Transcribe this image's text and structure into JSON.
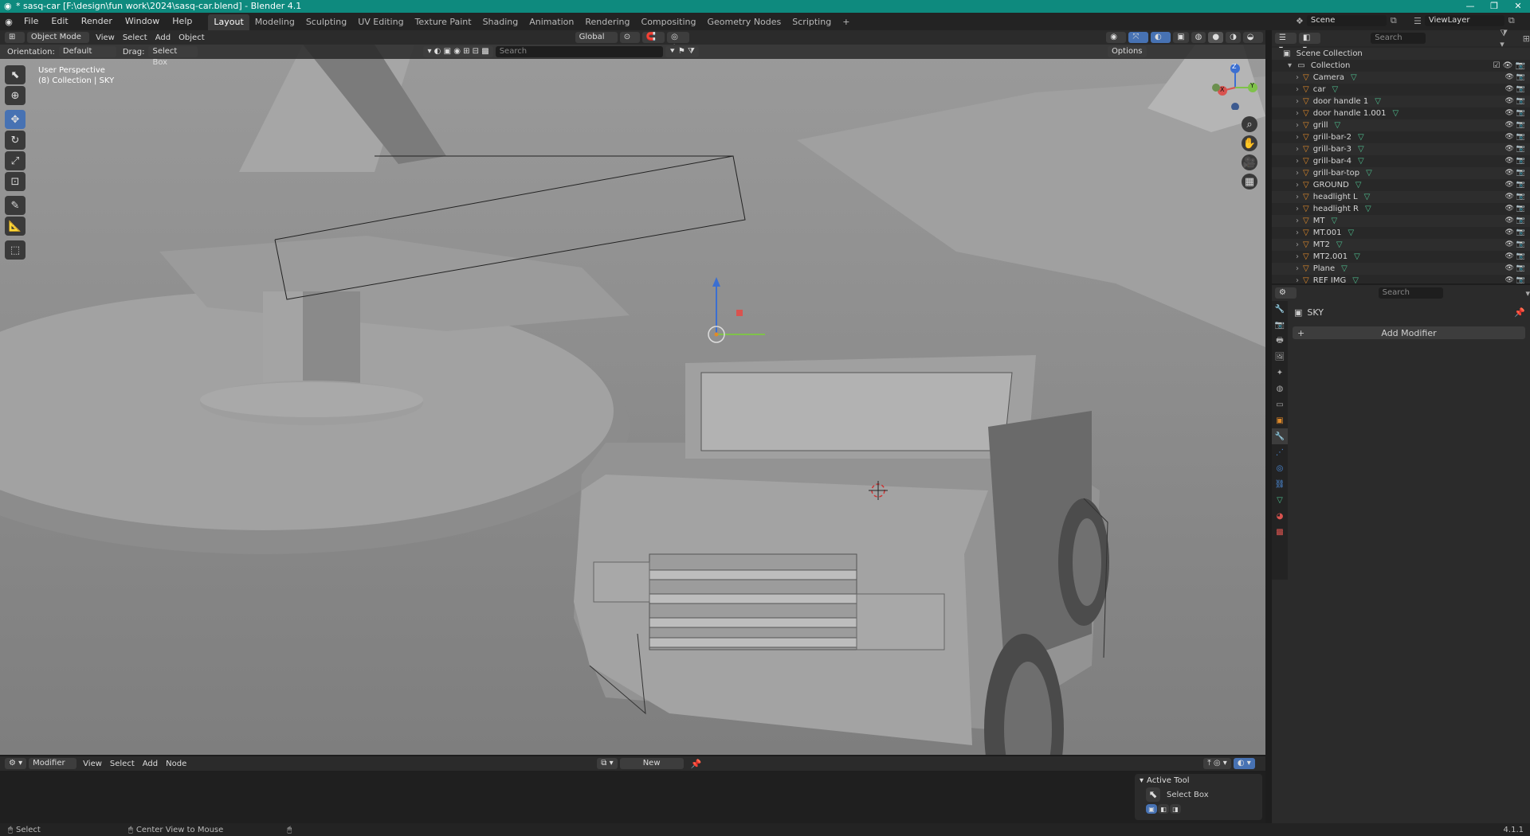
{
  "window": {
    "title": "* sasq-car [F:\\design\\fun work\\2024\\sasq-car.blend] - Blender 4.1"
  },
  "menu": [
    "File",
    "Edit",
    "Render",
    "Window",
    "Help"
  ],
  "workspaces": [
    "Layout",
    "Modeling",
    "Sculpting",
    "UV Editing",
    "Texture Paint",
    "Shading",
    "Animation",
    "Rendering",
    "Compositing",
    "Geometry Nodes",
    "Scripting"
  ],
  "active_workspace": "Layout",
  "scene": {
    "name": "Scene",
    "view_layer": "ViewLayer",
    "search_placeholder": "Search"
  },
  "viewport_header": {
    "mode": "Object Mode",
    "menus": [
      "View",
      "Select",
      "Add",
      "Object"
    ],
    "transform": "Global",
    "orientation_label": "Orientation:",
    "orientation_value": "Default",
    "drag_label": "Drag:",
    "drag_value": "Select Box",
    "search_placeholder": "Search",
    "options_label": "Options"
  },
  "viewport": {
    "view_name": "User Perspective",
    "collection_info": "(8) Collection | SKY"
  },
  "gizmo_axes": {
    "x": "X",
    "y": "Y",
    "z": "Z"
  },
  "outliner": {
    "root": "Scene Collection",
    "collection": "Collection",
    "items": [
      "Camera",
      "car",
      "door handle 1",
      "door handle 1.001",
      "grill",
      "grill-bar-2",
      "grill-bar-3",
      "grill-bar-4",
      "grill-bar-top",
      "GROUND",
      "headlight L",
      "headlight R",
      "MT",
      "MT.001",
      "MT2",
      "MT2.001",
      "Plane",
      "REF IMG"
    ]
  },
  "properties": {
    "search_placeholder": "Search",
    "object_name": "SKY",
    "add_modifier": "Add Modifier"
  },
  "bottom_editor": {
    "type": "Modifier",
    "menus": [
      "View",
      "Select",
      "Add",
      "Node"
    ],
    "new_label": "New",
    "active_tool_title": "Active Tool",
    "active_tool_name": "Select Box"
  },
  "statusbar": {
    "left": "Select",
    "middle": "Center View to Mouse",
    "version": "4.1.1"
  }
}
